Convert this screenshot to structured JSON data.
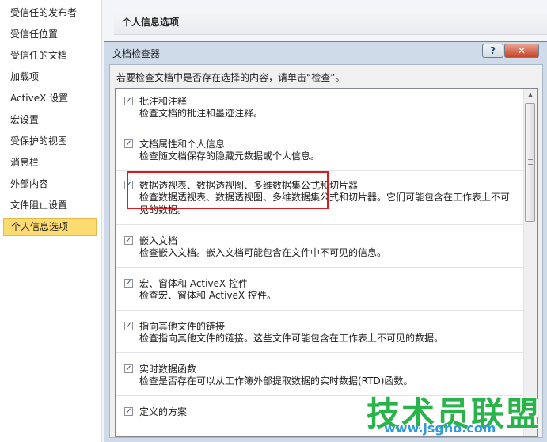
{
  "sidebar": {
    "items": [
      {
        "label": "受信任的发布者",
        "selected": false
      },
      {
        "label": "受信任位置",
        "selected": false
      },
      {
        "label": "受信任的文档",
        "selected": false
      },
      {
        "label": "加载项",
        "selected": false
      },
      {
        "label": "ActiveX 设置",
        "selected": false
      },
      {
        "label": "宏设置",
        "selected": false
      },
      {
        "label": "受保护的视图",
        "selected": false
      },
      {
        "label": "消息栏",
        "selected": false
      },
      {
        "label": "外部内容",
        "selected": false
      },
      {
        "label": "文件阻止设置",
        "selected": false
      },
      {
        "label": "个人信息选项",
        "selected": true
      }
    ]
  },
  "main": {
    "section_title": "个人信息选项"
  },
  "dialog": {
    "title": "文档检查器",
    "help_label": "?",
    "close_label": "✕",
    "instruction": "若要检查文档中是否存在选择的内容，请单击“检查”。",
    "items": [
      {
        "title": "批注和注释",
        "desc": "检查文档的批注和墨迹注释。",
        "checked": true
      },
      {
        "title": "文档属性和个人信息",
        "desc": "检查随文档保存的隐藏元数据或个人信息。",
        "checked": true,
        "highlighted": true
      },
      {
        "title": "数据透视表、数据透视图、多维数据集公式和切片器",
        "desc": "检查数据透视表、数据透视图、多维数据集公式和切片器。它们可能包含在工作表上不可见的数据。",
        "checked": true
      },
      {
        "title": "嵌入文档",
        "desc": "检查嵌入文档。嵌入文档可能包含在文件中不可见的信息。",
        "checked": true
      },
      {
        "title": "宏、窗体和 ActiveX 控件",
        "desc": "检查宏、窗体和 ActiveX 控件。",
        "checked": true
      },
      {
        "title": "指向其他文件的链接",
        "desc": "检查指向其他文件的链接。这些文件可能包含在工作表上不可见的数据。",
        "checked": true
      },
      {
        "title": "实时数据函数",
        "desc": "检查是否存在可以从工作簿外部提取数据的实时数据(RTD)函数。",
        "checked": true
      },
      {
        "title": "定义的方案",
        "desc": "",
        "checked": true
      }
    ],
    "scrollbar": {
      "position_fraction": 0.0
    }
  },
  "watermark": {
    "brand": "技术员联盟",
    "url": "www.jsgho.com"
  },
  "colors": {
    "selected_nav": "#fcdb73",
    "highlight_box": "#d81c1c",
    "dialog_frame": "#cfdbe9"
  }
}
